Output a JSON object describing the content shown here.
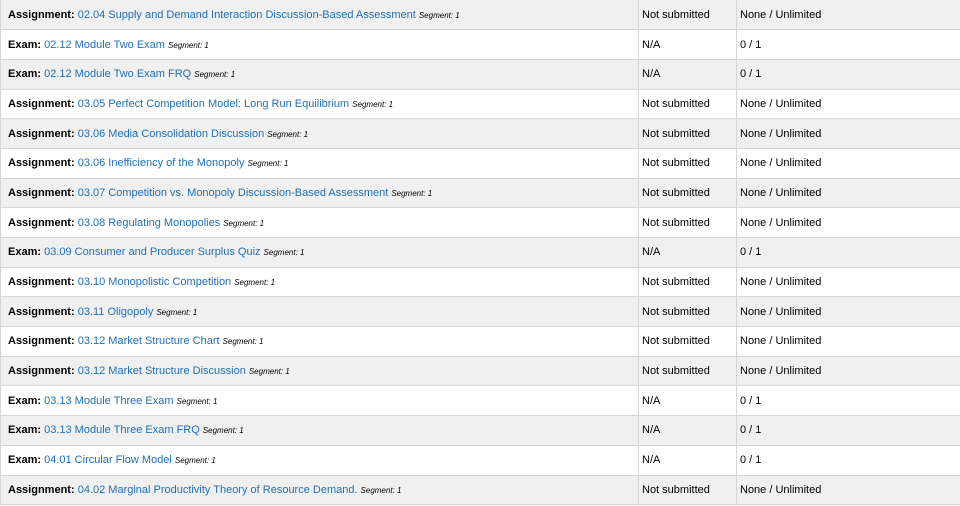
{
  "rows": [
    {
      "type": "Assignment",
      "title": "02.04 Supply and Demand Interaction Discussion-Based Assessment",
      "segment": "Segment: 1",
      "status": "Not submitted",
      "attempts": "None / Unlimited"
    },
    {
      "type": "Exam",
      "title": "02.12 Module Two Exam",
      "segment": "Segment: 1",
      "status": "N/A",
      "attempts": "0 / 1"
    },
    {
      "type": "Exam",
      "title": "02.12 Module Two Exam FRQ",
      "segment": "Segment: 1",
      "status": "N/A",
      "attempts": "0 / 1"
    },
    {
      "type": "Assignment",
      "title": "03.05 Perfect Competition Model: Long Run Equilibrium",
      "segment": "Segment: 1",
      "status": "Not submitted",
      "attempts": "None / Unlimited"
    },
    {
      "type": "Assignment",
      "title": "03.06 Media Consolidation Discussion",
      "segment": "Segment: 1",
      "status": "Not submitted",
      "attempts": "None / Unlimited"
    },
    {
      "type": "Assignment",
      "title": "03.06 Inefficiency of the Monopoly",
      "segment": "Segment: 1",
      "status": "Not submitted",
      "attempts": "None / Unlimited"
    },
    {
      "type": "Assignment",
      "title": "03.07 Competition vs. Monopoly Discussion-Based Assessment",
      "segment": "Segment: 1",
      "status": "Not submitted",
      "attempts": "None / Unlimited"
    },
    {
      "type": "Assignment",
      "title": "03.08 Regulating Monopolies",
      "segment": "Segment: 1",
      "status": "Not submitted",
      "attempts": "None / Unlimited"
    },
    {
      "type": "Exam",
      "title": "03.09 Consumer and Producer Surplus Quiz",
      "segment": "Segment: 1",
      "status": "N/A",
      "attempts": "0 / 1"
    },
    {
      "type": "Assignment",
      "title": "03.10 Monopolistic Competition",
      "segment": "Segment: 1",
      "status": "Not submitted",
      "attempts": "None / Unlimited"
    },
    {
      "type": "Assignment",
      "title": "03.11 Oligopoly",
      "segment": "Segment: 1",
      "status": "Not submitted",
      "attempts": "None / Unlimited"
    },
    {
      "type": "Assignment",
      "title": "03.12 Market Structure Chart",
      "segment": "Segment: 1",
      "status": "Not submitted",
      "attempts": "None / Unlimited"
    },
    {
      "type": "Assignment",
      "title": "03.12 Market Structure Discussion",
      "segment": "Segment: 1",
      "status": "Not submitted",
      "attempts": "None / Unlimited"
    },
    {
      "type": "Exam",
      "title": "03.13 Module Three Exam",
      "segment": "Segment: 1",
      "status": "N/A",
      "attempts": "0 / 1"
    },
    {
      "type": "Exam",
      "title": "03.13 Module Three Exam FRQ",
      "segment": "Segment: 1",
      "status": "N/A",
      "attempts": "0 / 1"
    },
    {
      "type": "Exam",
      "title": "04.01 Circular Flow Model",
      "segment": "Segment: 1",
      "status": "N/A",
      "attempts": "0 / 1"
    },
    {
      "type": "Assignment",
      "title": "04.02 Marginal Productivity Theory of Resource Demand.",
      "segment": "Segment: 1",
      "status": "Not submitted",
      "attempts": "None / Unlimited"
    }
  ]
}
